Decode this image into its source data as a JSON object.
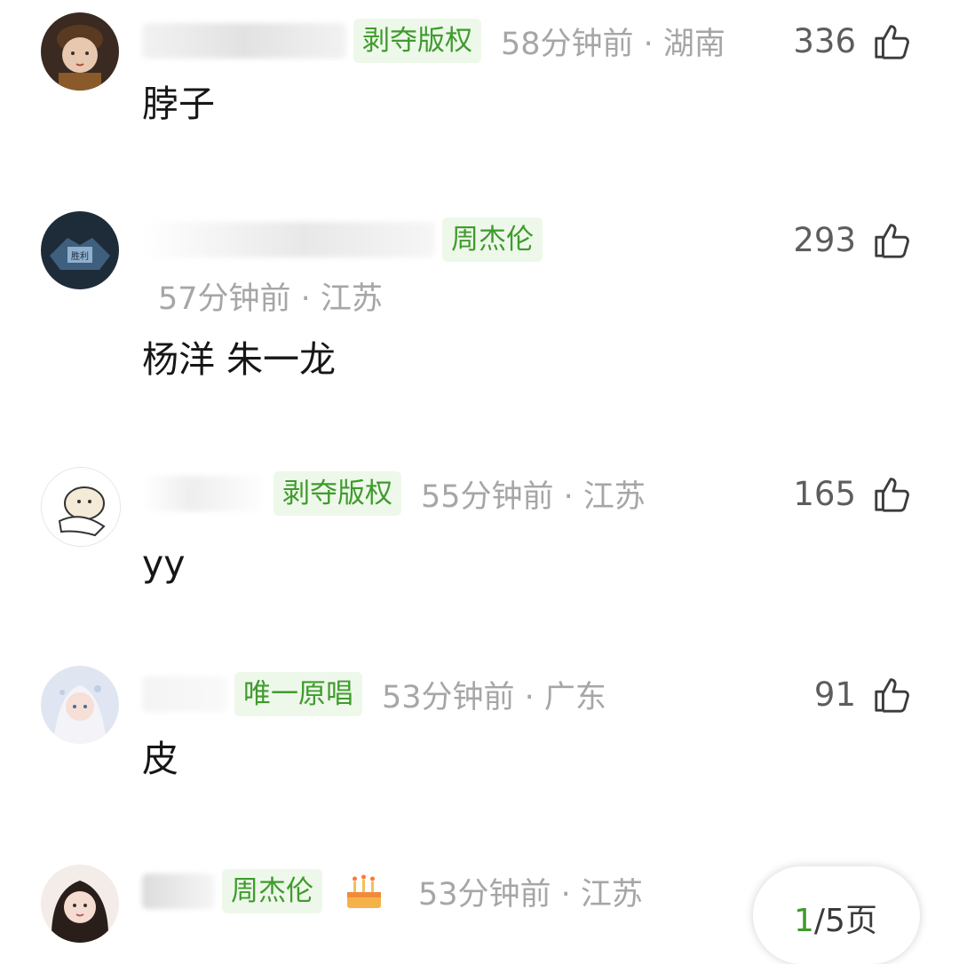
{
  "comments": [
    {
      "username": "",
      "badge": "剥夺版权",
      "time": "58分钟前 · 湖南",
      "likes": "336",
      "text": "脖子"
    },
    {
      "username": "",
      "badge": "周杰伦",
      "time": "57分钟前 · 江苏",
      "likes": "293",
      "text": "杨洋 朱一龙"
    },
    {
      "username": "",
      "badge": "剥夺版权",
      "time": "55分钟前 · 江苏",
      "likes": "165",
      "text": "yy"
    },
    {
      "username": "",
      "badge": "唯一原唱",
      "time": "53分钟前 · 广东",
      "likes": "91",
      "text": "皮"
    },
    {
      "username": "",
      "badge": "周杰伦",
      "time": "53分钟前 · 江苏",
      "likes": "",
      "text": ""
    }
  ],
  "pager": {
    "current": "1",
    "rest": "/5页"
  },
  "icons": {
    "like": "thumbs-up-icon",
    "cake": "birthday-cake-icon"
  },
  "colors": {
    "badge_text": "#3f9b2d",
    "badge_bg": "#eef8ea",
    "meta_gray": "#a6a6a6"
  }
}
